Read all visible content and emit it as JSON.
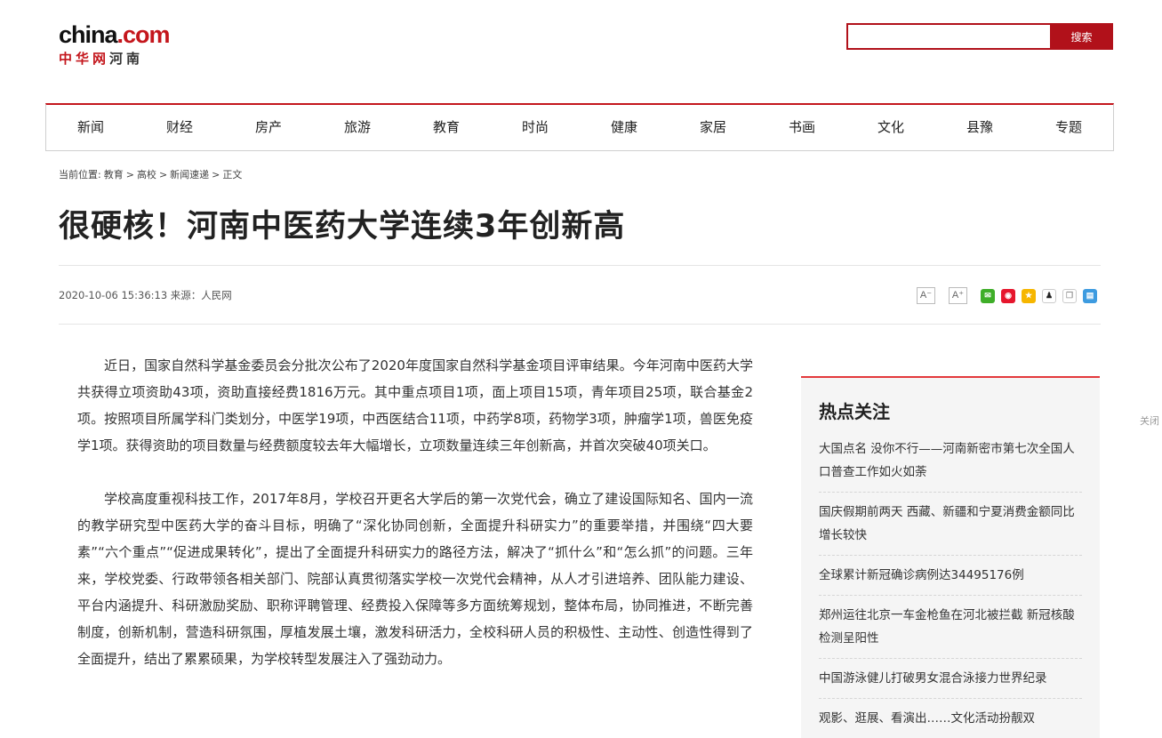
{
  "header": {
    "logo_main": "china",
    "logo_dot": ".com",
    "logo_sub_red": "中华网",
    "logo_sub_gray": "河南"
  },
  "search": {
    "value": "",
    "placeholder": "",
    "button_label": "搜索"
  },
  "nav": {
    "items": [
      "新闻",
      "财经",
      "房产",
      "旅游",
      "教育",
      "时尚",
      "健康",
      "家居",
      "书画",
      "文化",
      "县豫",
      "专题"
    ]
  },
  "breadcrumb": {
    "prefix": "当前位置:",
    "items": [
      "教育",
      "高校",
      "新闻速递",
      "正文"
    ],
    "separator": ">"
  },
  "article": {
    "title": "很硬核！河南中医药大学连续3年创新高",
    "datetime": "2020-10-06 15:36:13",
    "source_label": "来源：",
    "source": "人民网",
    "paragraphs": [
      "近日，国家自然科学基金委员会分批次公布了2020年度国家自然科学基金项目评审结果。今年河南中医药大学共获得立项资助43项，资助直接经费1816万元。其中重点项目1项，面上项目15项，青年项目25项，联合基金2项。按照项目所属学科门类划分，中医学19项，中西医结合11项，中药学8项，药物学3项，肿瘤学1项，兽医免疫学1项。获得资助的项目数量与经费额度较去年大幅增长，立项数量连续三年创新高，并首次突破40项关口。",
      "学校高度重视科技工作，2017年8月，学校召开更名大学后的第一次党代会，确立了建设国际知名、国内一流的教学研究型中医药大学的奋斗目标，明确了“深化协同创新，全面提升科研实力”的重要举措，并围绕“四大要素”“六个重点”“促进成果转化”，提出了全面提升科研实力的路径方法，解决了“抓什么”和“怎么抓”的问题。三年来，学校党委、行政带领各相关部门、院部认真贯彻落实学校一次党代会精神，从人才引进培养、团队能力建设、平台内涵提升、科研激励奖励、职称评聘管理、经费投入保障等多方面统筹规划，整体布局，协同推进，不断完善制度，创新机制，营造科研氛围，厚植发展土壤，激发科研活力，全校科研人员的积极性、主动性、创造性得到了全面提升，结出了累累硕果，为学校转型发展注入了强劲动力。"
    ]
  },
  "tools": {
    "font_smaller": "A⁻",
    "font_larger": "A⁺",
    "share_icons": [
      {
        "name": "wechat-icon",
        "glyph": "✉"
      },
      {
        "name": "weibo-icon",
        "glyph": "◉"
      },
      {
        "name": "qzone-icon",
        "glyph": "★"
      },
      {
        "name": "qq-icon",
        "glyph": "♟"
      },
      {
        "name": "copy-icon",
        "glyph": "❐"
      },
      {
        "name": "print-icon",
        "glyph": "▤"
      }
    ]
  },
  "sidebar": {
    "title": "热点关注",
    "items": [
      "大国点名 没你不行——河南新密市第七次全国人口普查工作如火如荼",
      "国庆假期前两天 西藏、新疆和宁夏消费金额同比增长较快",
      "全球累计新冠确诊病例达34495176例",
      "郑州运往北京一车金枪鱼在河北被拦截 新冠核酸检测呈阳性",
      "中国游泳健儿打破男女混合泳接力世界纪录",
      "观影、逛展、看演出……文化活动扮靓双"
    ]
  },
  "floating": {
    "close_label": "关闭"
  }
}
